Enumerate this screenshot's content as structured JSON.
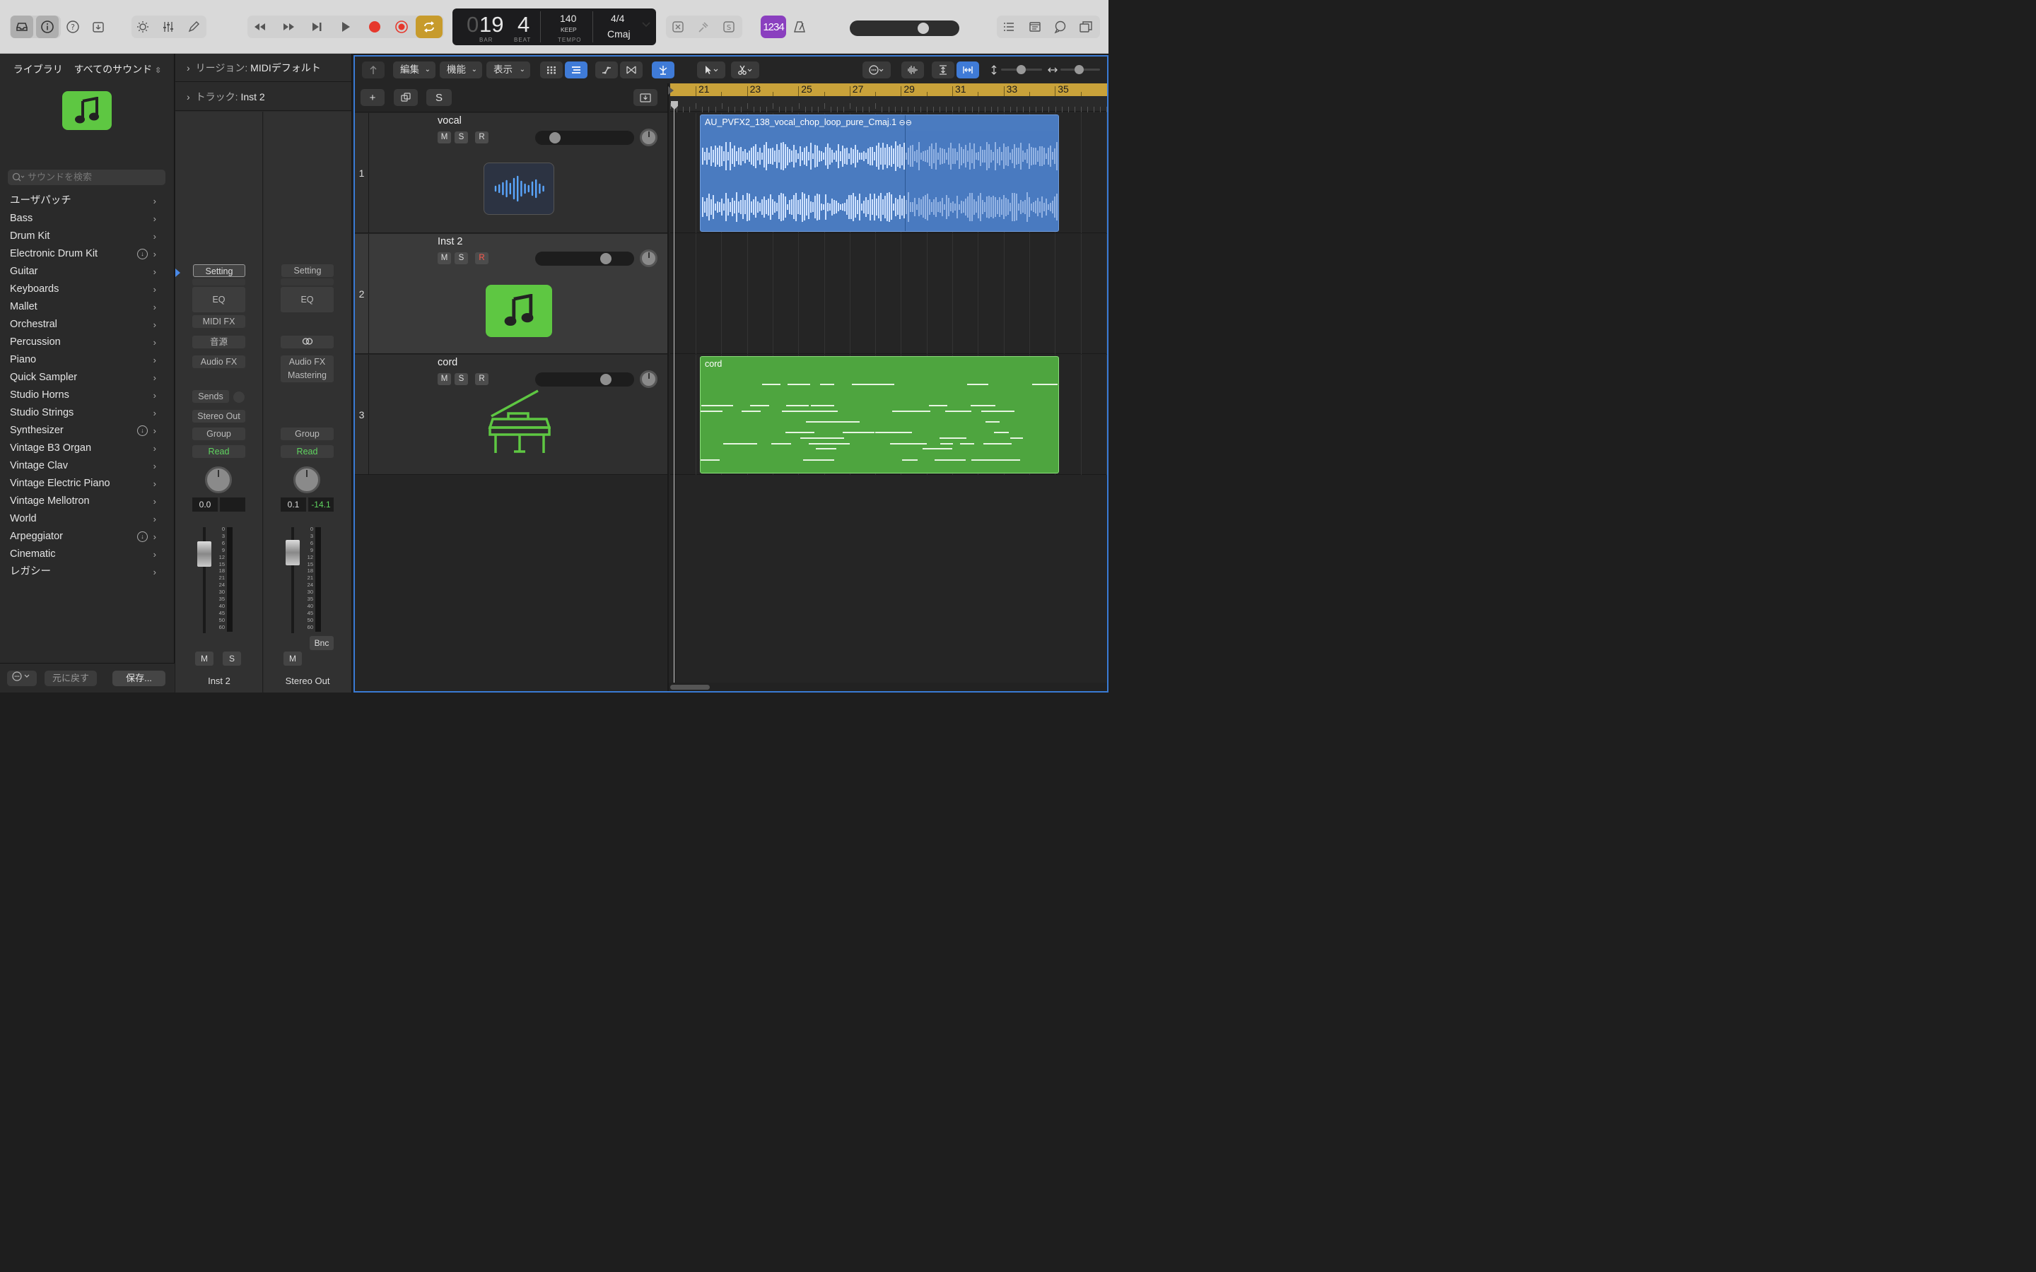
{
  "controlbar": {
    "lcd": {
      "bar_prefix": "0",
      "bar": "19",
      "beat": "4",
      "bar_label": "BAR",
      "beat_label": "BEAT",
      "tempo": "140",
      "tempo_mode": "KEEP",
      "tempo_label": "TEMPO",
      "signature": "4/4",
      "key": "Cmaj"
    },
    "count_in": "1234",
    "master_volume": 0.7
  },
  "library": {
    "tab": "ライブラリ",
    "filter": "すべてのサウンド",
    "search_placeholder": "サウンドを検索",
    "items": [
      {
        "label": "ユーザパッチ",
        "download": false
      },
      {
        "label": "Bass",
        "download": false
      },
      {
        "label": "Drum Kit",
        "download": false
      },
      {
        "label": "Electronic Drum Kit",
        "download": true
      },
      {
        "label": "Guitar",
        "download": false
      },
      {
        "label": "Keyboards",
        "download": false
      },
      {
        "label": "Mallet",
        "download": false
      },
      {
        "label": "Orchestral",
        "download": false
      },
      {
        "label": "Percussion",
        "download": false
      },
      {
        "label": "Piano",
        "download": false
      },
      {
        "label": "Quick Sampler",
        "download": false
      },
      {
        "label": "Studio Horns",
        "download": false
      },
      {
        "label": "Studio Strings",
        "download": false
      },
      {
        "label": "Synthesizer",
        "download": true
      },
      {
        "label": "Vintage B3 Organ",
        "download": false
      },
      {
        "label": "Vintage Clav",
        "download": false
      },
      {
        "label": "Vintage Electric Piano",
        "download": false
      },
      {
        "label": "Vintage Mellotron",
        "download": false
      },
      {
        "label": "World",
        "download": false
      },
      {
        "label": "Arpeggiator",
        "download": true
      },
      {
        "label": "Cinematic",
        "download": false
      },
      {
        "label": "レガシー",
        "download": false
      }
    ],
    "footer": {
      "revert": "元に戻す",
      "save": "保存..."
    }
  },
  "inspector": {
    "region_label": "リージョン:",
    "region_value": "MIDIデフォルト",
    "track_label": "トラック:",
    "track_value": "Inst 2",
    "strip1": {
      "setting": "Setting",
      "eq": "EQ",
      "midifx": "MIDI FX",
      "instrument": "音源",
      "audiofx": "Audio FX",
      "sends": "Sends",
      "output": "Stereo Out",
      "group": "Group",
      "automation": "Read",
      "gain": "0.0",
      "m": "M",
      "s": "S",
      "name": "Inst 2"
    },
    "strip2": {
      "setting": "Setting",
      "eq": "EQ",
      "audiofx": "Audio FX",
      "plugin": "Mastering",
      "group": "Group",
      "automation": "Read",
      "gain": "0.1",
      "peak": "-14.1",
      "bnc": "Bnc",
      "m": "M",
      "name": "Stereo Out"
    },
    "scale": [
      "0",
      "3",
      "6",
      "9",
      "12",
      "15",
      "18",
      "21",
      "24",
      "30",
      "35",
      "40",
      "45",
      "50",
      "60"
    ]
  },
  "tracks_toolbar": {
    "edit": "編集",
    "functions": "機能",
    "view": "表示"
  },
  "tracks_header": {
    "add": "+",
    "solo": "S"
  },
  "tracks": [
    {
      "num": "1",
      "name": "vocal",
      "m": "M",
      "s": "S",
      "r": "R",
      "volume": 0.15,
      "icon": "waveform-icon",
      "armed": false
    },
    {
      "num": "2",
      "name": "Inst 2",
      "m": "M",
      "s": "S",
      "r": "R",
      "volume": 0.75,
      "icon": "music-note-icon",
      "armed": true
    },
    {
      "num": "3",
      "name": "cord",
      "m": "M",
      "s": "S",
      "r": "R",
      "volume": 0.75,
      "icon": "grand-piano-icon",
      "armed": false
    }
  ],
  "ruler": [
    "21",
    "23",
    "25",
    "27",
    "29",
    "31",
    "33",
    "35"
  ],
  "regions": {
    "vocal": "AU_PVFX2_138_vocal_chop_loop_pure_Cmaj.1",
    "cord": "cord"
  },
  "colors": {
    "audio_region": "#4a7bc0",
    "midi_region": "#4ea53f",
    "ruler": "#c9a23a",
    "accent": "#3f7bd7",
    "record": "#e6382c",
    "cycle": "#c79b2c",
    "library_patch": "#5ec742"
  }
}
